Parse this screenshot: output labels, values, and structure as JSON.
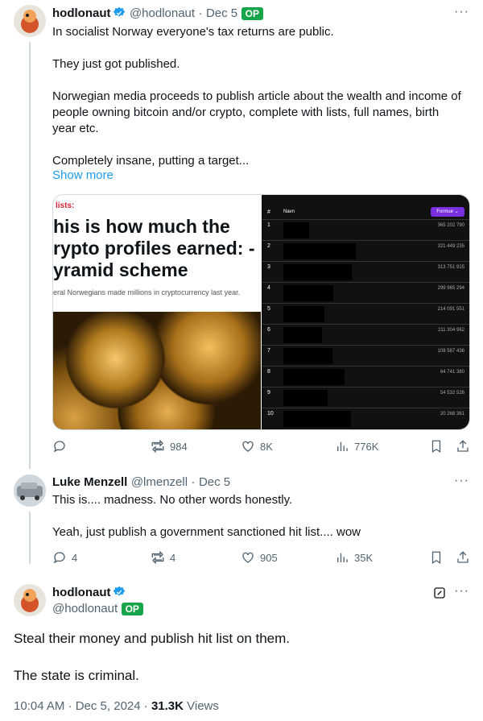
{
  "tweet1": {
    "name": "hodlonaut",
    "handle": "@hodlonaut",
    "date": "Dec 5",
    "op_badge": "OP",
    "text": "In socialist Norway everyone's tax returns are public.\n\nThey just got published.\n\nNorwegian media proceeds to publish article about the wealth and income of people owning bitcoin and/or crypto, complete with lists, full names, birth year etc.\n\nCompletely insane, putting a target...",
    "show_more": "Show more",
    "image_left": {
      "kicker": "lists:",
      "headline": "his is how much the\nrypto profiles earned: -\nyramid scheme",
      "subline": "eral Norwegians made millions in cryptocurrency last year."
    },
    "image_right": {
      "col_num": "#",
      "col_name": "Navn",
      "col_sort": "Formue",
      "rows": [
        {
          "n": "1",
          "value": "365 202 790"
        },
        {
          "n": "2",
          "value": "321 449 235"
        },
        {
          "n": "3",
          "value": "313 751 915"
        },
        {
          "n": "4",
          "value": "299 965 294"
        },
        {
          "n": "5",
          "value": "214 091 551"
        },
        {
          "n": "6",
          "value": "211 304 962"
        },
        {
          "n": "7",
          "value": "108 587 436"
        },
        {
          "n": "8",
          "value": "64 741 380"
        },
        {
          "n": "9",
          "value": "54 532 526"
        },
        {
          "n": "10",
          "value": "20 268 361"
        }
      ]
    },
    "actions": {
      "replies": "",
      "reposts": "984",
      "likes": "8K",
      "views": "776K"
    }
  },
  "tweet2": {
    "name": "Luke Menzell",
    "handle": "@lmenzell",
    "date": "Dec 5",
    "text": "This is.... madness. No other words honestly.\n\nYeah, just publish a government sanctioned hit list.... wow",
    "actions": {
      "replies": "4",
      "reposts": "4",
      "likes": "905",
      "views": "35K"
    }
  },
  "tweet3": {
    "name": "hodlonaut",
    "handle": "@hodlonaut",
    "op_badge": "OP",
    "text": "Steal their money and publish hit list on them.\n\nThe state is criminal.",
    "time": "10:04 AM · Dec 5, 2024 · ",
    "views_count": "31.3K",
    "views_label": " Views"
  },
  "colors": {
    "accent": "#1d9bf0",
    "op_green": "#17a54a",
    "muted": "#536471"
  },
  "icons": [
    "reply-icon",
    "repost-icon",
    "like-icon",
    "views-icon",
    "bookmark-icon",
    "share-icon",
    "verified-icon",
    "edit-icon",
    "more-icon"
  ]
}
